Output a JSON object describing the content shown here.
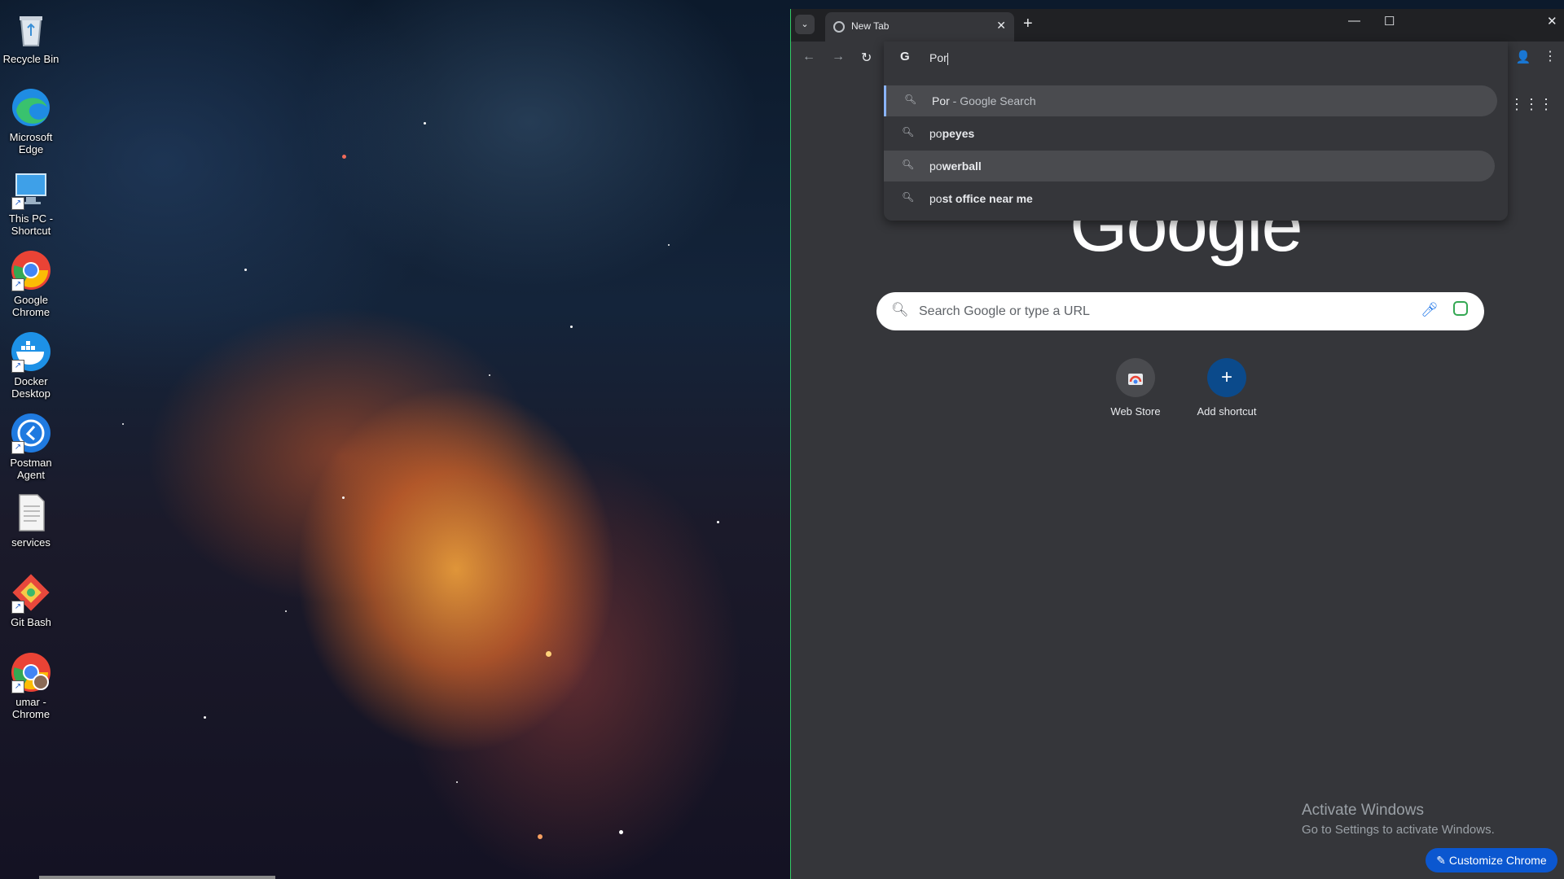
{
  "desktop": {
    "icons": [
      {
        "label": "Recycle Bin",
        "icon": "recycle-bin-icon"
      },
      {
        "label": "Microsoft Edge",
        "icon": "edge-icon"
      },
      {
        "label": "This PC - Shortcut",
        "icon": "this-pc-icon"
      },
      {
        "label": "Google Chrome",
        "icon": "chrome-icon"
      },
      {
        "label": "Docker Desktop",
        "icon": "docker-icon"
      },
      {
        "label": "Postman Agent",
        "icon": "postman-icon"
      },
      {
        "label": "services",
        "icon": "text-file-icon"
      },
      {
        "label": "Git Bash",
        "icon": "git-bash-icon"
      },
      {
        "label": "umar - Chrome",
        "icon": "chrome-profile-icon"
      }
    ]
  },
  "browser": {
    "tab": {
      "title": "New Tab"
    },
    "omnibox": {
      "typed": "Por",
      "suggestions": [
        {
          "match": "Por",
          "rest": " - Google Search"
        },
        {
          "match": "po",
          "rest": "peyes"
        },
        {
          "match": "po",
          "rest": "werball"
        },
        {
          "match": "po",
          "rest": "st office near me"
        }
      ]
    },
    "page": {
      "logo": "Google",
      "search_placeholder": "Search Google or type a URL",
      "shortcuts": [
        {
          "label": "Web Store"
        },
        {
          "label": "Add shortcut",
          "symbol": "+"
        }
      ],
      "customize_label": "Customize Chrome"
    }
  },
  "activation": {
    "title": "Activate Windows",
    "subtitle": "Go to Settings to activate Windows."
  },
  "colors": {
    "browser_bg": "#35363a",
    "tabstrip_bg": "#202124",
    "accent": "#0b57d0"
  }
}
